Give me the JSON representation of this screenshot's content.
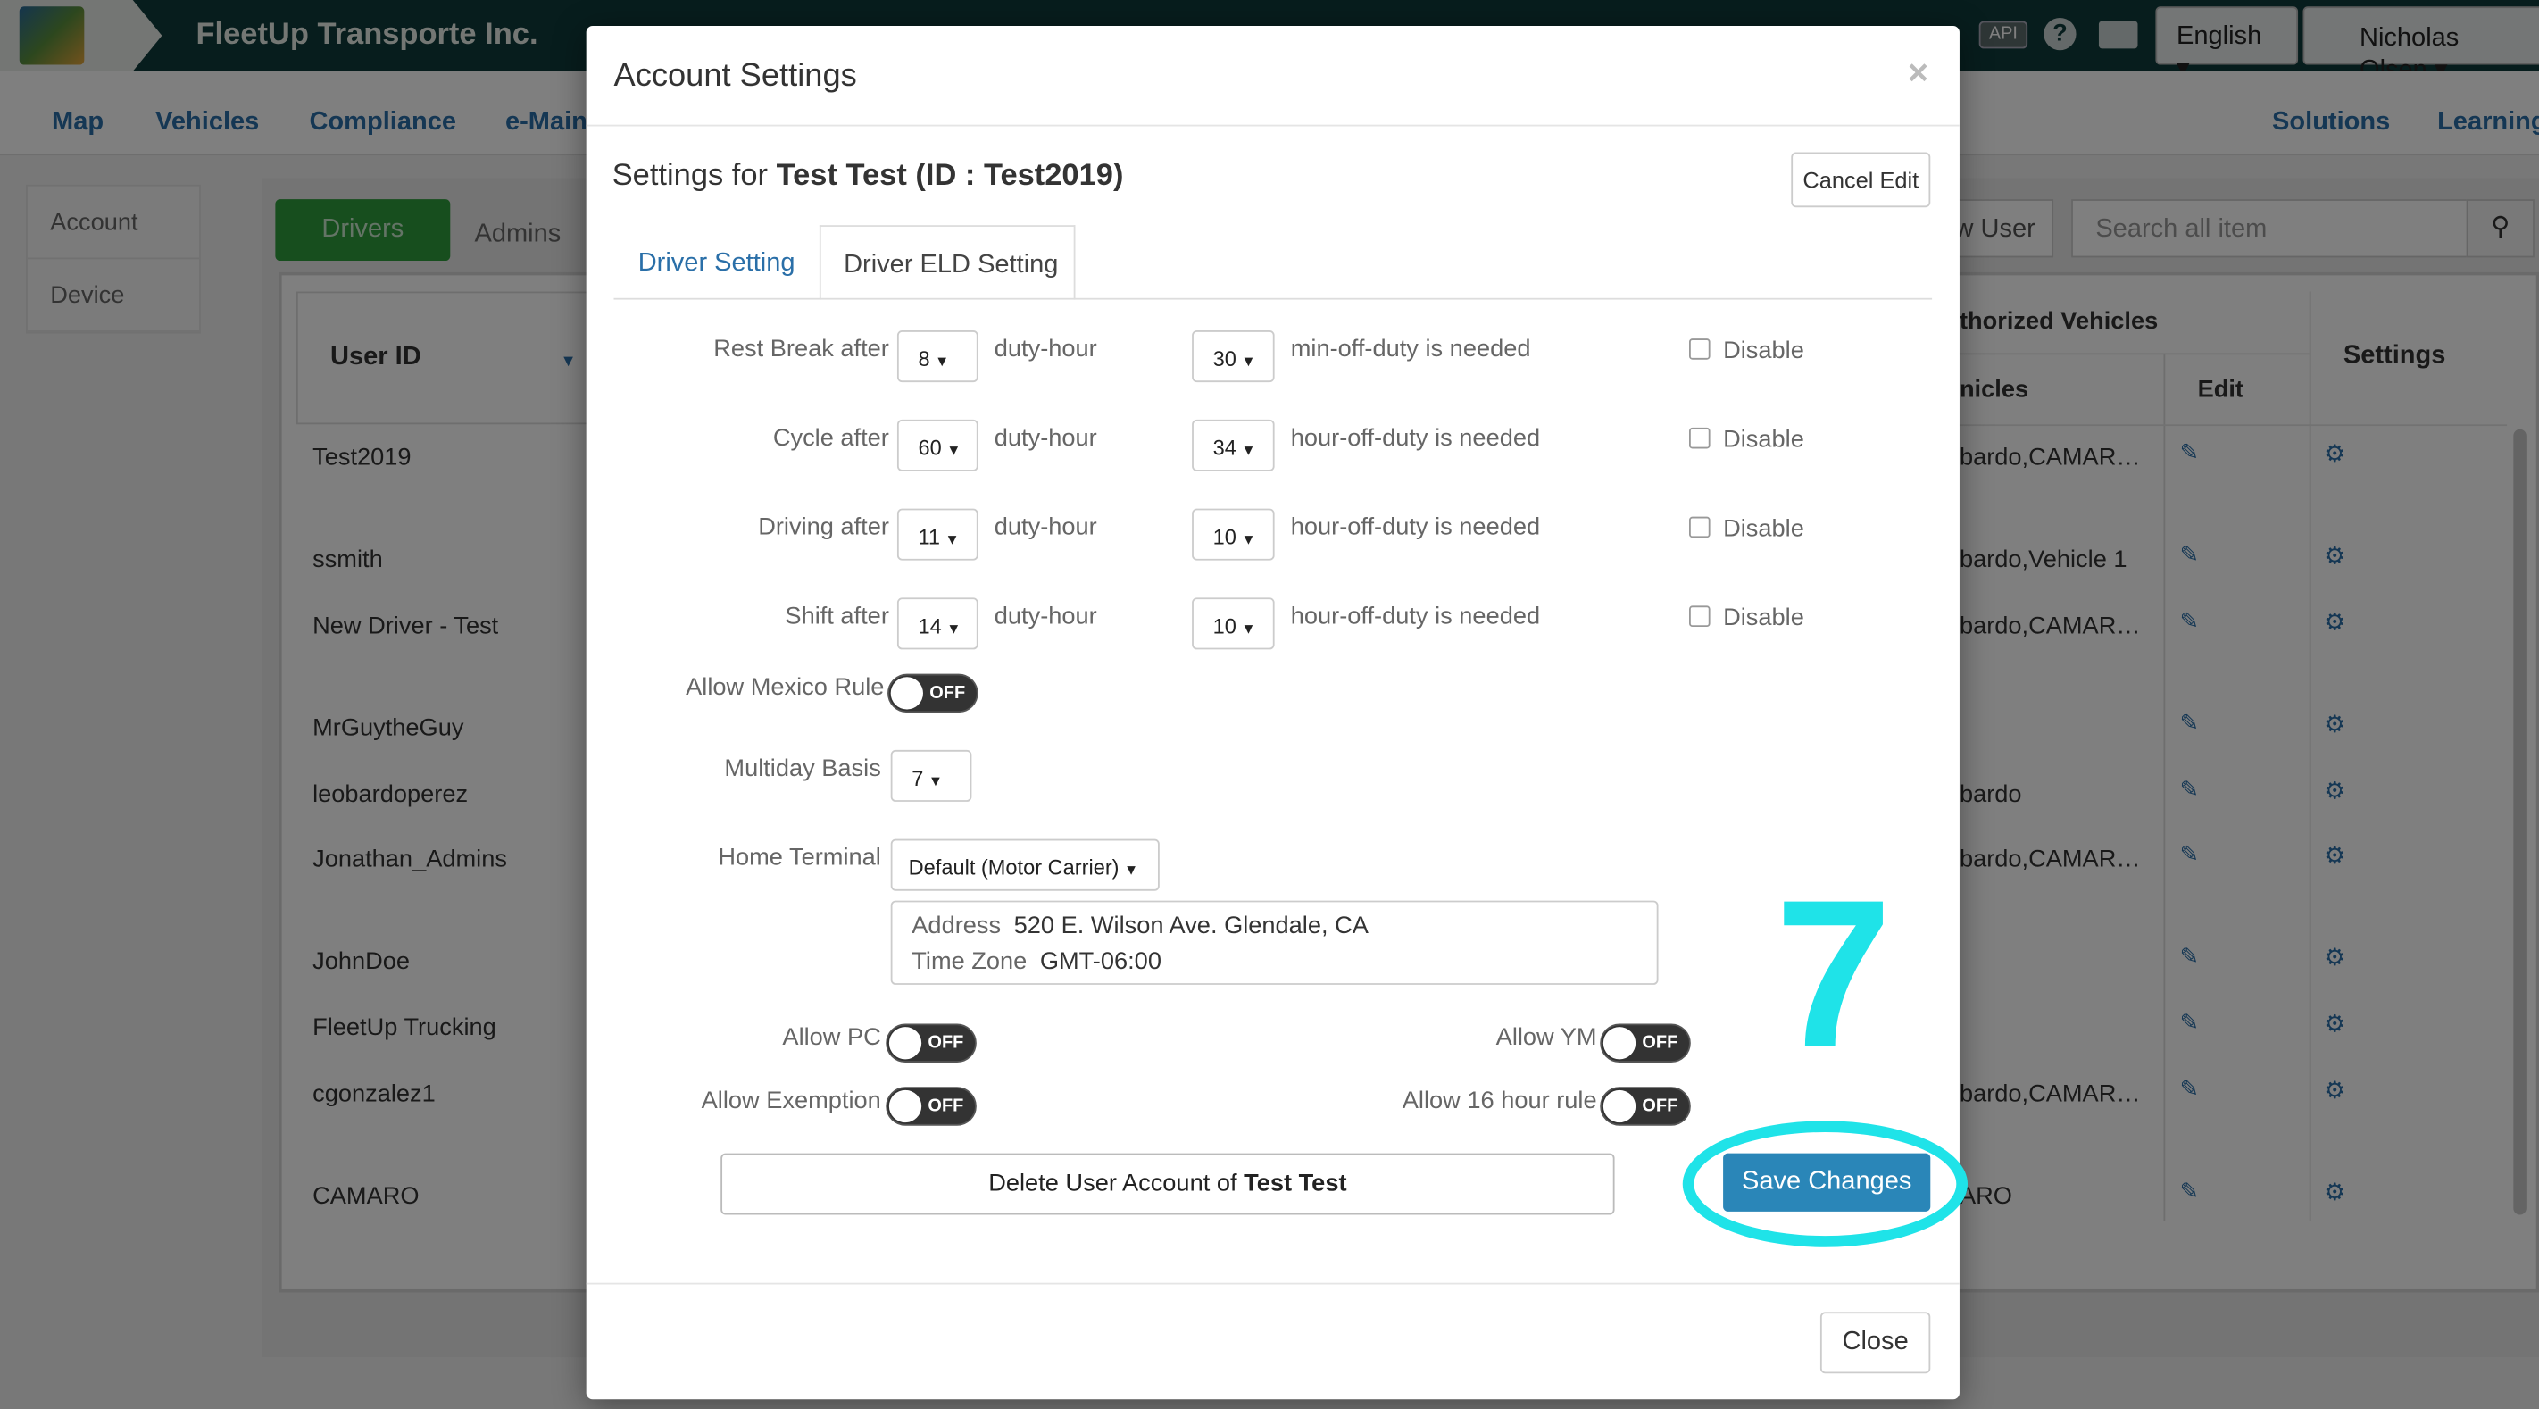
{
  "header": {
    "company": "FleetUp Transporte Inc.",
    "api_label": "API",
    "help_icon": "question-circle-icon",
    "folder_icon": "folder-open-icon",
    "language": "English ▾",
    "user": "Nicholas Olsen ▾"
  },
  "nav": {
    "items": [
      "Map",
      "Vehicles",
      "Compliance",
      "e-Main",
      "Solutions",
      "Learning"
    ]
  },
  "sidebar": {
    "items": [
      "Account",
      "Device"
    ]
  },
  "page": {
    "tab_drivers": "Drivers",
    "tab_admins": "Admins",
    "new_user": "w User",
    "search_placeholder": "Search all item",
    "col_user_id": "User ID",
    "col_authorized": "thorized Vehicles",
    "col_vehicles": "nicles",
    "col_edit": "Edit",
    "col_settings": "Settings"
  },
  "rows": [
    {
      "id": "Test2019",
      "vehicles": "bardo,CAMAR…"
    },
    {
      "id": "ssmith",
      "vehicles": "bardo,Vehicle 1"
    },
    {
      "id": "New Driver - Test",
      "vehicles": "bardo,CAMAR…"
    },
    {
      "id": "MrGuytheGuy",
      "vehicles": ""
    },
    {
      "id": "leobardoperez",
      "vehicles": "bardo"
    },
    {
      "id": "Jonathan_Admins",
      "vehicles": "bardo,CAMAR…"
    },
    {
      "id": "JohnDoe",
      "vehicles": ""
    },
    {
      "id": "FleetUp Trucking",
      "vehicles": ""
    },
    {
      "id": "cgonzalez1",
      "vehicles": "bardo,CAMAR…"
    },
    {
      "id": "CAMARO",
      "vehicles": "ARO"
    }
  ],
  "modal": {
    "title": "Account Settings",
    "close_x": "×",
    "settings_for": "Settings for",
    "user_name_id": "Test Test (ID : Test2019)",
    "cancel_edit": "Cancel Edit",
    "tab_driver_setting": "Driver Setting",
    "tab_eld_setting": "Driver ELD Setting",
    "rules": [
      {
        "label": "Rest Break after",
        "value": "8",
        "unit": "duty-hour",
        "off_value": "30",
        "off_text": "min-off-duty is needed",
        "disable": "Disable"
      },
      {
        "label": "Cycle after",
        "value": "60",
        "unit": "duty-hour",
        "off_value": "34",
        "off_text": "hour-off-duty is needed",
        "disable": "Disable"
      },
      {
        "label": "Driving after",
        "value": "11",
        "unit": "duty-hour",
        "off_value": "10",
        "off_text": "hour-off-duty is needed",
        "disable": "Disable"
      },
      {
        "label": "Shift after",
        "value": "14",
        "unit": "duty-hour",
        "off_value": "10",
        "off_text": "hour-off-duty is needed",
        "disable": "Disable"
      }
    ],
    "allow_mexico": "Allow Mexico Rule",
    "toggle_off": "OFF",
    "multiday_label": "Multiday Basis",
    "multiday_value": "7",
    "home_terminal_label": "Home Terminal",
    "home_terminal_value": "Default (Motor Carrier)",
    "address_key": "Address",
    "address_value": "520 E. Wilson Ave. Glendale, CA",
    "timezone_key": "Time Zone",
    "timezone_value": "GMT-06:00",
    "allow_pc": "Allow PC",
    "allow_ym": "Allow YM",
    "allow_exemption": "Allow Exemption",
    "allow_16": "Allow 16 hour rule",
    "delete_prefix": "Delete User Account of ",
    "delete_name": "Test Test",
    "save": "Save Changes",
    "close": "Close"
  },
  "annotation": {
    "step": "7",
    "color": "#1fe3e8"
  }
}
